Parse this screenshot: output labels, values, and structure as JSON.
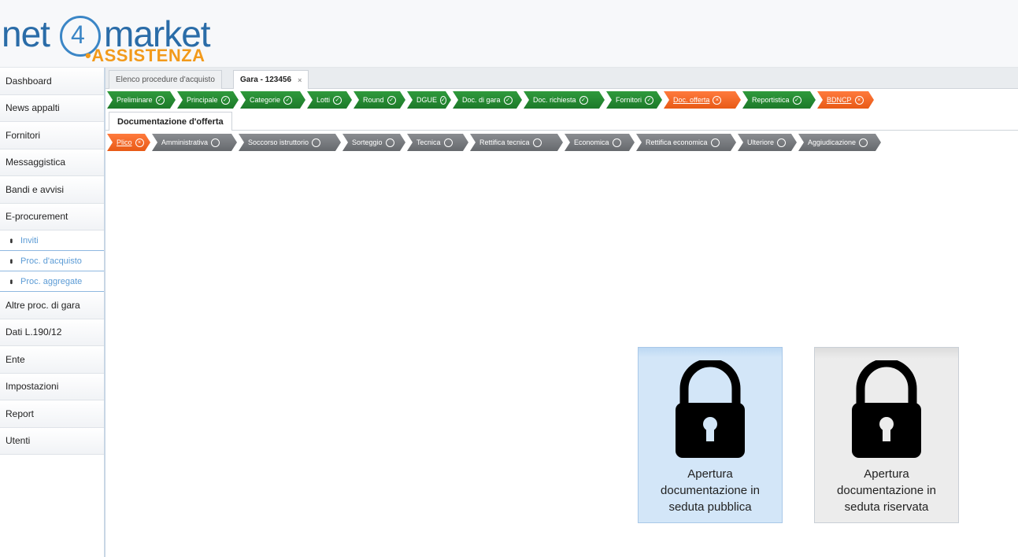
{
  "logo": {
    "part1": "net",
    "part2": "4",
    "part3": "market",
    "part4": "ASSISTENZA"
  },
  "sidebar": {
    "items": [
      {
        "label": "Dashboard"
      },
      {
        "label": "News appalti"
      },
      {
        "label": "Fornitori"
      },
      {
        "label": "Messaggistica"
      },
      {
        "label": "Bandi e avvisi"
      },
      {
        "label": "E-procurement"
      }
    ],
    "subitems": [
      {
        "label": "Inviti"
      },
      {
        "label": "Proc. d'acquisto"
      },
      {
        "label": "Proc. aggregate"
      }
    ],
    "items2": [
      {
        "label": "Altre proc. di gara"
      },
      {
        "label": "Dati L.190/12"
      },
      {
        "label": "Ente"
      },
      {
        "label": "Impostazioni"
      },
      {
        "label": "Report"
      },
      {
        "label": "Utenti"
      }
    ]
  },
  "tabs": [
    {
      "label": "Elenco procedure d'acquisto"
    },
    {
      "label": "Gara - 123456",
      "close": "×"
    }
  ],
  "steps": [
    {
      "label": "Preliminare",
      "status": "done",
      "icon": "check-circle-icon",
      "mark": "✓"
    },
    {
      "label": "Principale",
      "status": "done",
      "icon": "check-circle-icon",
      "mark": "✓"
    },
    {
      "label": "Categorie",
      "status": "done",
      "icon": "check-circle-icon",
      "mark": "✓"
    },
    {
      "label": "Lotti",
      "status": "done",
      "icon": "check-circle-icon",
      "mark": "✓"
    },
    {
      "label": "Round",
      "status": "done",
      "icon": "check-circle-icon",
      "mark": "✓"
    },
    {
      "label": "DGUE",
      "status": "done",
      "icon": "check-circle-icon",
      "mark": "✓"
    },
    {
      "label": "Doc. di gara",
      "status": "done",
      "icon": "check-circle-icon",
      "mark": "✓"
    },
    {
      "label": "Doc. richiesta",
      "status": "done",
      "icon": "check-circle-icon",
      "mark": "✓"
    },
    {
      "label": "Fornitori",
      "status": "done",
      "icon": "check-circle-icon",
      "mark": "✓"
    },
    {
      "label": "Doc. offerta",
      "status": "current",
      "icon": "x-circle-icon",
      "mark": "×"
    },
    {
      "label": "Reportistica",
      "status": "done",
      "icon": "check-circle-icon",
      "mark": "✓"
    },
    {
      "label": "BDNCP",
      "status": "current",
      "icon": "x-circle-icon",
      "mark": "×"
    }
  ],
  "subtab": {
    "label": "Documentazione d'offerta"
  },
  "substeps": [
    {
      "label": "Plico",
      "status": "current",
      "icon": "x-circle-icon",
      "mark": "×"
    },
    {
      "label": "Amministrativa",
      "status": "pending",
      "icon": "empty-circle-icon",
      "mark": ""
    },
    {
      "label": "Soccorso istruttorio",
      "status": "pending",
      "icon": "empty-circle-icon",
      "mark": ""
    },
    {
      "label": "Sorteggio",
      "status": "pending",
      "icon": "empty-circle-icon",
      "mark": ""
    },
    {
      "label": "Tecnica",
      "status": "pending",
      "icon": "empty-circle-icon",
      "mark": ""
    },
    {
      "label": "Rettifica tecnica",
      "status": "pending",
      "icon": "empty-circle-icon",
      "mark": ""
    },
    {
      "label": "Economica",
      "status": "pending",
      "icon": "empty-circle-icon",
      "mark": ""
    },
    {
      "label": "Rettifica economica",
      "status": "pending",
      "icon": "empty-circle-icon",
      "mark": ""
    },
    {
      "label": "Ulteriore",
      "status": "pending",
      "icon": "empty-circle-icon",
      "mark": ""
    },
    {
      "label": "Aggiudicazione",
      "status": "pending",
      "icon": "empty-circle-icon",
      "mark": ""
    }
  ],
  "actions": {
    "public": {
      "label": "Apertura documentazione in seduta pubblica",
      "icon": "lock-icon"
    },
    "private": {
      "label": "Apertura documentazione in seduta riservata",
      "icon": "lock-icon"
    }
  },
  "colors": {
    "done": "#1d7a2a",
    "current": "#e85a16",
    "pending": "#66696d",
    "brand": "#2a6ca8",
    "brand_accent": "#f29a1b"
  }
}
